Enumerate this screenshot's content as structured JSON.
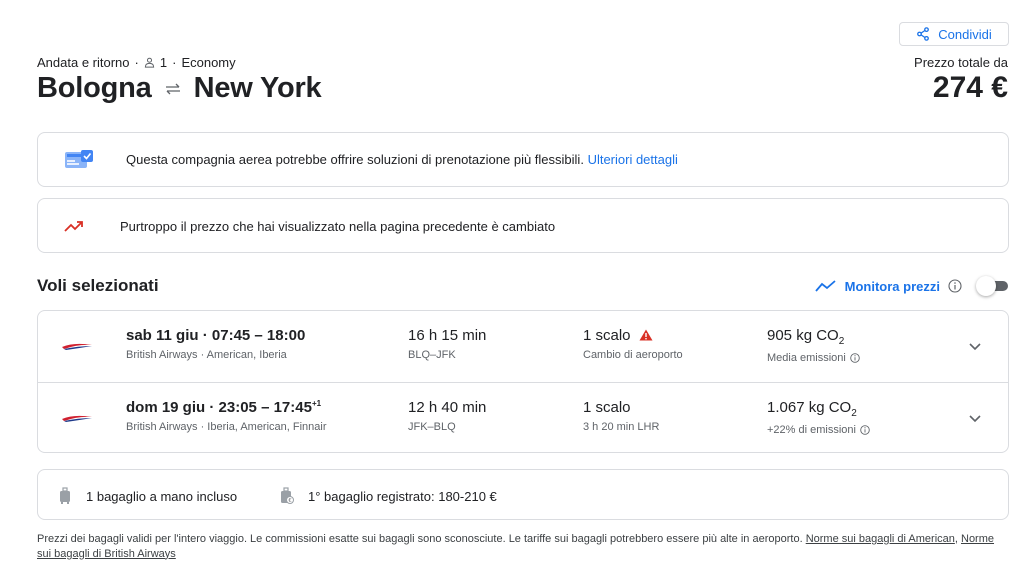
{
  "share": {
    "label": "Condividi"
  },
  "trip": {
    "type": "Andata e ritorno",
    "passengers": "1",
    "cabin": "Economy",
    "origin": "Bologna",
    "destination": "New York",
    "price_label": "Prezzo totale da",
    "price": "274 €"
  },
  "notice_booking": {
    "text": "Questa compagnia aerea potrebbe offrire soluzioni di prenotazione più flessibili.",
    "link": "Ulteriori dettagli"
  },
  "notice_price": {
    "text": "Purtroppo il prezzo che hai visualizzato nella pagina precedente è cambiato"
  },
  "selected": {
    "title": "Voli selezionati",
    "track_label": "Monitora prezzi",
    "track_enabled": false
  },
  "flights": [
    {
      "date": "sab 11 giu",
      "times": "07:45 – 18:00",
      "arrival_offset": "",
      "airlines": "British Airways · American, Iberia",
      "duration": "16 h 15 min",
      "route": "BLQ–JFK",
      "stops": "1 scalo",
      "stop_detail": "Cambio di aeroporto",
      "co2_value": "905 kg CO",
      "co2_sub": "2",
      "emissions_note": "Media emissioni"
    },
    {
      "date": "dom 19 giu",
      "times": "23:05 – 17:45",
      "arrival_offset": "+1",
      "airlines": "British Airways · Iberia, American, Finnair",
      "duration": "12 h 40 min",
      "route": "JFK–BLQ",
      "stops": "1 scalo",
      "stop_detail": "3 h 20 min LHR",
      "co2_value": "1.067 kg CO",
      "co2_sub": "2",
      "emissions_note": "+22% di emissioni"
    }
  ],
  "baggage": {
    "carry_on": "1 bagaglio a mano incluso",
    "checked": "1° bagaglio registrato: 180-210 €"
  },
  "footnote": {
    "text": "Prezzi dei bagagli validi per l'intero viaggio. Le commissioni esatte sui bagagli sono sconosciute. Le tariffe sui bagagli potrebbero essere più alte in aeroporto.",
    "link_american": "Norme sui bagagli di American",
    "separator": ",",
    "link_ba": "Norme sui bagagli di British Airways"
  },
  "colors": {
    "accent": "#1a73e8",
    "warning": "#d93025",
    "border": "#dadce0",
    "text_secondary": "#5f6368",
    "ba_red": "#d0202f",
    "ba_blue": "#1e3a8a"
  }
}
